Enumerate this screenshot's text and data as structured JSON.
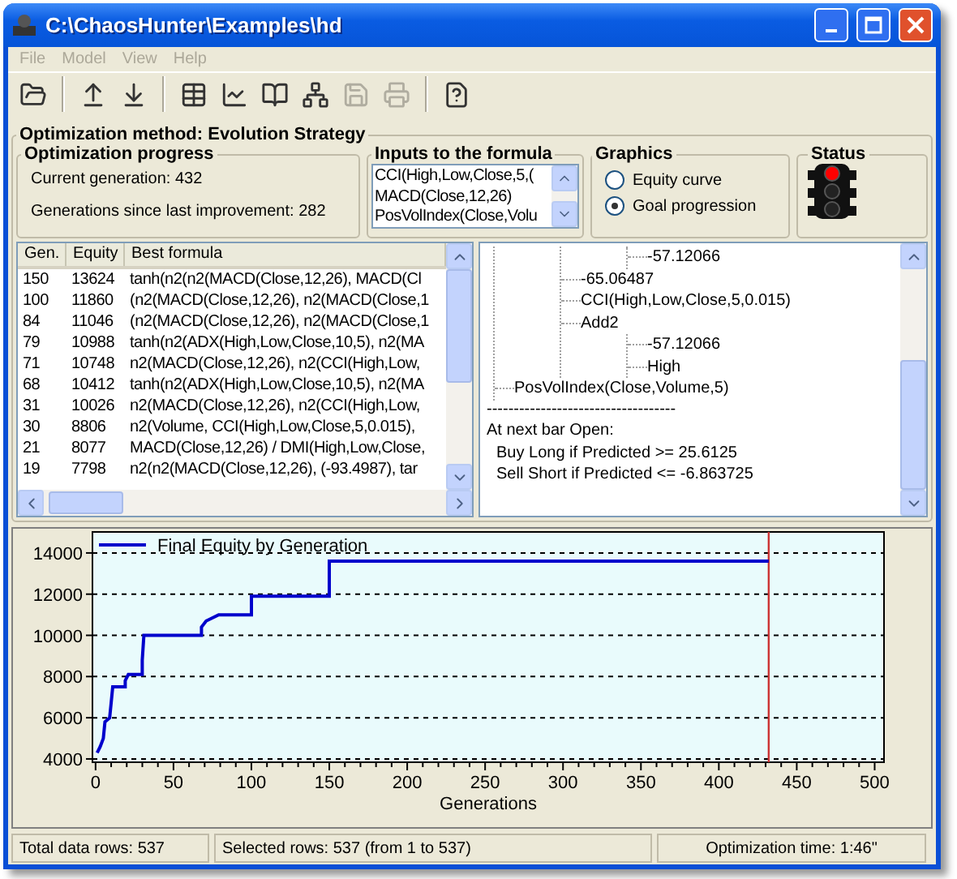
{
  "window": {
    "title": "C:\\ChaosHunter\\Examples\\hd"
  },
  "menu": [
    {
      "label": "File",
      "disabled": true
    },
    {
      "label": "Model",
      "disabled": true
    },
    {
      "label": "View",
      "disabled": true
    },
    {
      "label": "Help",
      "disabled": true
    }
  ],
  "toolbar": [
    [
      {
        "kind": "open",
        "disabled": false
      }
    ],
    [
      {
        "kind": "import",
        "disabled": false
      },
      {
        "kind": "export",
        "disabled": false
      }
    ],
    [
      {
        "kind": "table",
        "disabled": false
      },
      {
        "kind": "chart",
        "disabled": false
      },
      {
        "kind": "book",
        "disabled": false
      },
      {
        "kind": "network",
        "disabled": false
      },
      {
        "kind": "save",
        "disabled": true
      },
      {
        "kind": "print",
        "disabled": true
      }
    ],
    [
      {
        "kind": "help",
        "disabled": false
      }
    ]
  ],
  "method_group": {
    "title": "Optimization method: Evolution Strategy"
  },
  "progress": {
    "title": "Optimization progress",
    "lines": [
      "Current generation:  432",
      "Generations since last improvement:  282"
    ]
  },
  "inputs": {
    "title": "Inputs to the formula",
    "items": [
      "CCI(High,Low,Close,5,(",
      "MACD(Close,12,26)",
      "PosVolIndex(Close,Volu"
    ]
  },
  "graphics": {
    "title": "Graphics",
    "options": [
      {
        "label": "Equity curve",
        "selected": false
      },
      {
        "label": "Goal progression",
        "selected": true
      }
    ]
  },
  "status": {
    "title": "Status",
    "lights": [
      {
        "on": true
      },
      {
        "on": false
      },
      {
        "on": false
      }
    ]
  },
  "table": {
    "columns": [
      "Gen.",
      "Equity",
      "Best formula"
    ],
    "rows": [
      [
        "150",
        "13624",
        "tanh(n2(n2(MACD(Close,12,26), MACD(Cl"
      ],
      [
        "100",
        "11860",
        "(n2(MACD(Close,12,26), n2(MACD(Close,1"
      ],
      [
        "84",
        "11046",
        "(n2(MACD(Close,12,26), n2(MACD(Close,1"
      ],
      [
        "79",
        "10988",
        "tanh(n2(ADX(High,Low,Close,10,5), n2(MA"
      ],
      [
        "71",
        "10748",
        "n2(MACD(Close,12,26), n2(CCI(High,Low,"
      ],
      [
        "68",
        "10412",
        "tanh(n2(ADX(High,Low,Close,10,5), n2(MA"
      ],
      [
        "31",
        "10026",
        "n2(MACD(Close,12,26), n2(CCI(High,Low,"
      ],
      [
        "30",
        "8806",
        "n2(Volume, CCI(High,Low,Close,5,0.015),"
      ],
      [
        "21",
        "8077",
        "MACD(Close,12,26) / DMI(High,Low,Close,"
      ],
      [
        "19",
        "7798",
        "n2(n2(MACD(Close,12,26), (-93.4987), tar"
      ]
    ]
  },
  "tree": {
    "nodes": [
      {
        "children": [
          {
            "children": [
              {
                "label": "-57.12066"
              }
            ]
          },
          {
            "label": "-65.06487"
          },
          {
            "label": "CCI(High,Low,Close,5,0.015)"
          },
          {
            "label": "Add2",
            "children": [
              {
                "label": "-57.12066"
              },
              {
                "label": "High"
              }
            ]
          }
        ]
      },
      {
        "label": "PosVolIndex(Close,Volume,5)"
      }
    ],
    "rule": "-----------------------------------",
    "lines": [
      "At next bar Open:",
      "Buy Long if Predicted >= 25.6125",
      "Sell Short if Predicted <= -6.863725"
    ]
  },
  "chart": {
    "chart_data": {
      "type": "line",
      "xlabel": "Generations",
      "xlim": [
        -2,
        506
      ],
      "ylim": [
        3840,
        15020
      ],
      "xticks": [
        0,
        50,
        100,
        150,
        200,
        250,
        300,
        350,
        400,
        450,
        500
      ],
      "yticks": [
        4000,
        6000,
        8000,
        10000,
        12000,
        14000
      ],
      "x": [
        1,
        3,
        5,
        6,
        9,
        10,
        11,
        19,
        19,
        21,
        30,
        30,
        31,
        68,
        68,
        71,
        79,
        84,
        100,
        100,
        150,
        150,
        432
      ],
      "series": [
        {
          "name": "Final Equity by Generation",
          "color": "#0000cc",
          "values": [
            4300,
            4600,
            5000,
            5800,
            6000,
            6700,
            7500,
            7500,
            7800,
            8100,
            8100,
            8800,
            10000,
            10000,
            10400,
            10700,
            11000,
            11000,
            11000,
            11900,
            11900,
            13600,
            13600
          ]
        }
      ],
      "grid": true,
      "ref_lines": [
        {
          "axis": "x",
          "value": 432,
          "color": "#cc3333"
        }
      ]
    }
  },
  "status_bar": [
    "Total data rows: 537",
    "Selected rows: 537  (from 1 to 537)",
    "Optimization time: 1:46\""
  ]
}
